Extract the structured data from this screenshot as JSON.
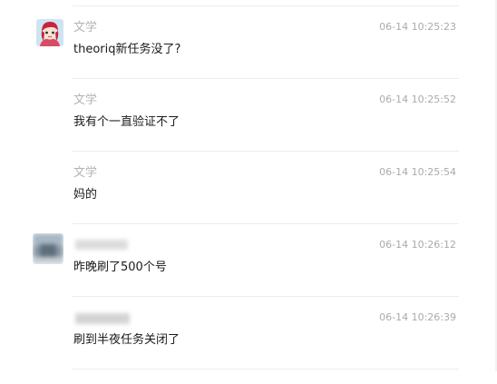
{
  "messages": [
    {
      "name": "文学",
      "time": "06-14 10:25:23",
      "text": "theoriq新任务没了?"
    },
    {
      "name": "文学",
      "time": "06-14 10:25:52",
      "text": "我有个一直验证不了"
    },
    {
      "name": "文学",
      "time": "06-14 10:25:54",
      "text": "妈的"
    },
    {
      "name": "",
      "time": "06-14 10:26:12",
      "text": "昨晚刷了500个号"
    },
    {
      "name": "",
      "time": "06-14 10:26:39",
      "text": "刷到半夜任务关闭了"
    }
  ],
  "colors": {
    "name": "#b3b3b3",
    "time": "#aaaaaa",
    "text": "#1a1a1a",
    "separator": "#ececec"
  },
  "icons": {
    "avatar_1": "anime-girl-avatar",
    "avatar_2": "blurred-avatar"
  }
}
